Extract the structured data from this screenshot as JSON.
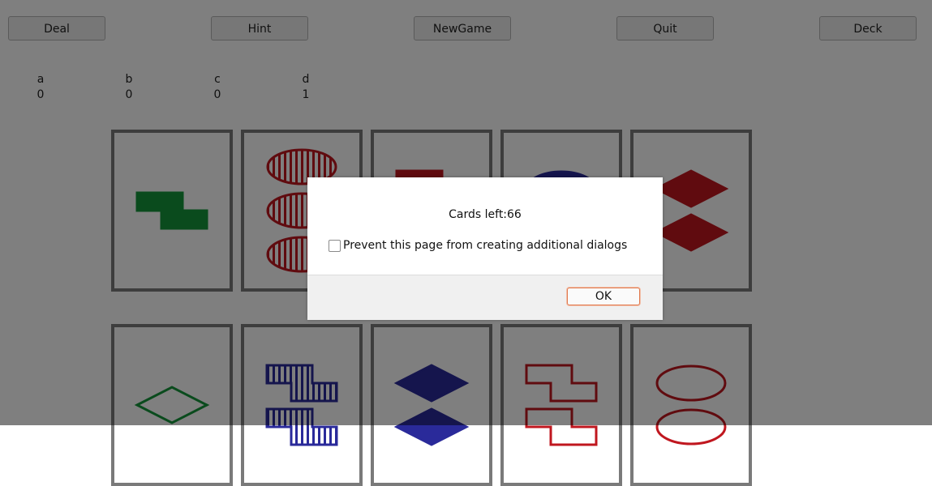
{
  "toolbar": {
    "deal_label": "Deal",
    "hint_label": "Hint",
    "newgame_label": "NewGame",
    "quit_label": "Quit",
    "deck_label": "Deck"
  },
  "scores": [
    {
      "player": "a",
      "score": "0"
    },
    {
      "player": "b",
      "score": "0"
    },
    {
      "player": "c",
      "score": "0"
    },
    {
      "player": "d",
      "score": "1"
    }
  ],
  "colors": {
    "red": "#c0171f",
    "green": "#15963a",
    "blue": "#2a2a9a"
  },
  "cards": [
    {
      "row": 1,
      "col": 1,
      "count": 1,
      "shape": "squiggle",
      "color": "green",
      "shading": "solid"
    },
    {
      "row": 1,
      "col": 2,
      "count": 3,
      "shape": "oval",
      "color": "red",
      "shading": "striped"
    },
    {
      "row": 1,
      "col": 3,
      "count": 2,
      "shape": "squiggle",
      "color": "red",
      "shading": "solid"
    },
    {
      "row": 1,
      "col": 4,
      "count": 2,
      "shape": "oval",
      "color": "blue",
      "shading": "solid"
    },
    {
      "row": 1,
      "col": 5,
      "count": 2,
      "shape": "diamond",
      "color": "red",
      "shading": "solid"
    },
    {
      "row": 2,
      "col": 1,
      "count": 1,
      "shape": "diamond",
      "color": "green",
      "shading": "open"
    },
    {
      "row": 2,
      "col": 2,
      "count": 2,
      "shape": "squiggle",
      "color": "blue",
      "shading": "striped"
    },
    {
      "row": 2,
      "col": 3,
      "count": 2,
      "shape": "diamond",
      "color": "blue",
      "shading": "solid"
    },
    {
      "row": 2,
      "col": 4,
      "count": 2,
      "shape": "squiggle",
      "color": "red",
      "shading": "open"
    },
    {
      "row": 2,
      "col": 5,
      "count": 2,
      "shape": "oval",
      "color": "red",
      "shading": "open"
    }
  ],
  "dialog": {
    "message": "Cards left:66",
    "prevent_label": "Prevent this page from creating additional dialogs",
    "ok_label": "OK"
  }
}
